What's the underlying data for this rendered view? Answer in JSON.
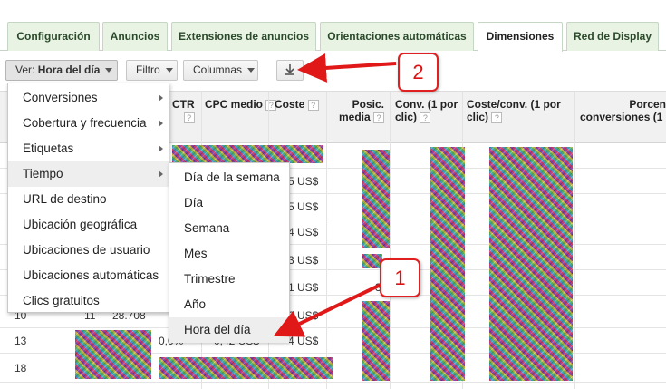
{
  "tabs": [
    "Configuración",
    "Anuncios",
    "Extensiones de anuncios",
    "Orientaciones automáticas",
    "Dimensiones",
    "Red de Display"
  ],
  "active_tab": "Dimensiones",
  "toolbar": {
    "view_label": "Ver:",
    "view_value": "Hora del día",
    "filter_label": "Filtro",
    "columns_label": "Columnas"
  },
  "table": {
    "headers": {
      "ctr": "CTR",
      "cpc": "CPC medio",
      "cost": "Coste",
      "pos_line1": "Posic.",
      "pos_line2": "media",
      "conv_line1": "Conv. (1 por",
      "conv_line2": "clic)",
      "costconv_line1": "Coste/conv. (1 por",
      "costconv_line2": "clic)",
      "rate_line1": "Porcen",
      "rate_line2": "conversiones (1 p"
    },
    "cost_fragments": [
      "5 US$",
      "5 US$",
      "4 US$",
      "3 US$",
      "1 US$",
      "0 US$",
      "4 US$"
    ],
    "pos_fragment": "3",
    "rows": [
      {
        "hour": "10",
        "clicks": "11",
        "impr": "28.708",
        "ctr": "",
        "cpc": ""
      },
      {
        "hour": "13",
        "clicks": "",
        "impr": "",
        "ctr": "0,0%",
        "cpc": "0,42 US$"
      },
      {
        "hour": "18",
        "clicks": "",
        "impr": "",
        "ctr": "",
        "cpc": ""
      }
    ]
  },
  "menu": {
    "items": [
      {
        "label": "Conversiones",
        "submenu": true
      },
      {
        "label": "Cobertura y frecuencia",
        "submenu": true
      },
      {
        "label": "Etiquetas",
        "submenu": true
      },
      {
        "label": "Tiempo",
        "submenu": true
      },
      {
        "label": "URL de destino",
        "submenu": false
      },
      {
        "label": "Ubicación geográfica",
        "submenu": false
      },
      {
        "label": "Ubicaciones de usuario",
        "submenu": false
      },
      {
        "label": "Ubicaciones automáticas",
        "submenu": false
      },
      {
        "label": "Clics gratuitos",
        "submenu": false
      }
    ],
    "highlighted": "Tiempo"
  },
  "submenu": {
    "items": [
      "Día de la semana",
      "Día",
      "Semana",
      "Mes",
      "Trimestre",
      "Año",
      "Hora del día"
    ],
    "highlighted": "Hora del día"
  },
  "callouts": [
    "1",
    "2"
  ],
  "colors": {
    "tab_bg": "#e8f3e3",
    "accent_red": "#e02020"
  },
  "icons": {
    "download": "download-icon",
    "submenu_arrow": "chevron-right-icon",
    "dropdown": "chevron-down-icon",
    "help": "help-icon"
  }
}
